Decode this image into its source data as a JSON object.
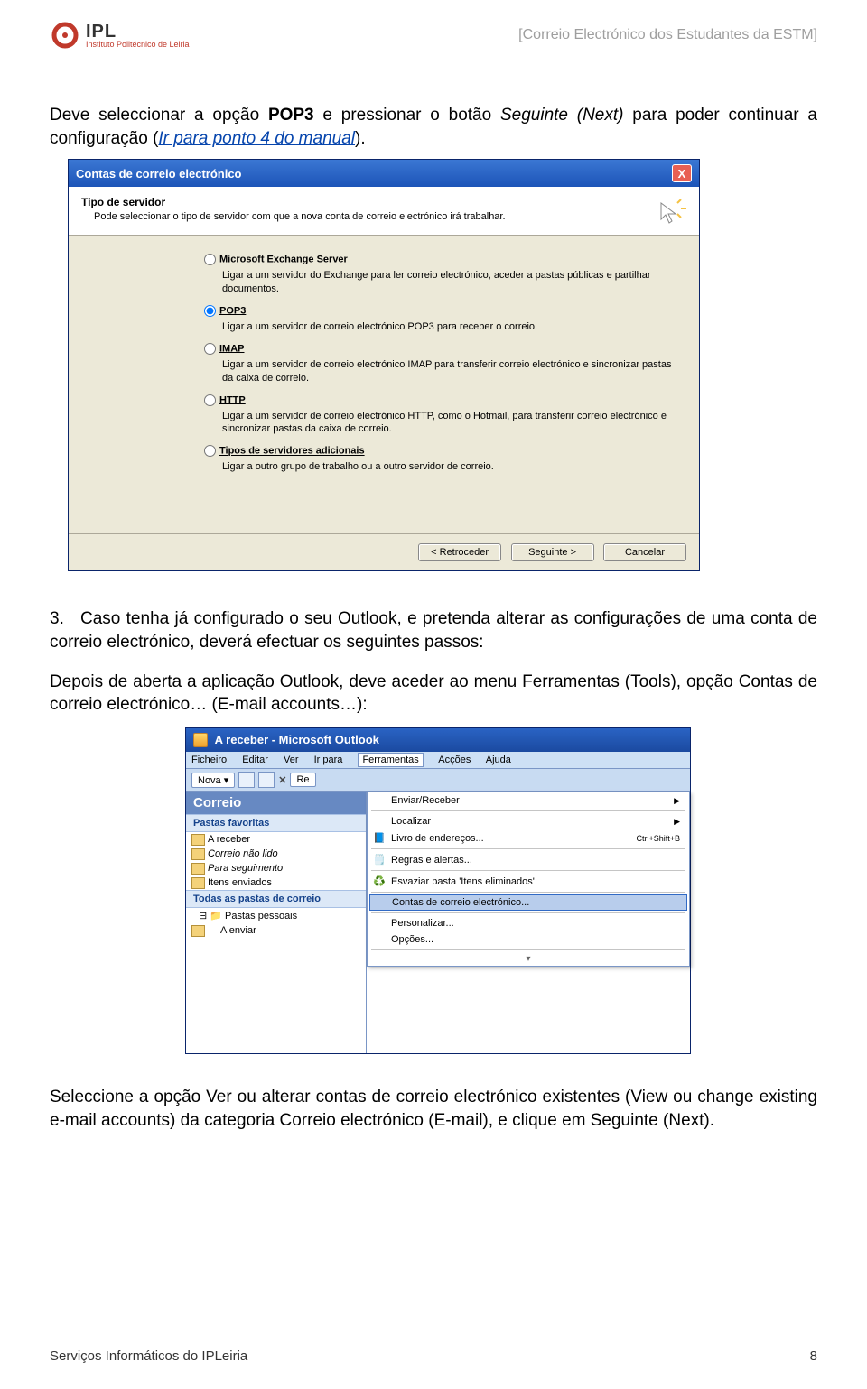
{
  "header": {
    "logo_text": "IPL",
    "logo_sub": "Instituto Politécnico de Leiria",
    "right": "[Correio Electrónico dos Estudantes da ESTM]"
  },
  "intro": {
    "p1_a": "Deve seleccionar a opção ",
    "p1_b": "POP3",
    "p1_c": " e pressionar o botão ",
    "p1_d": "Seguinte (Next)",
    "p1_e": " para poder continuar a configuração (",
    "p1_link": "Ir para ponto 4 do manual",
    "p1_f": ")."
  },
  "dialog": {
    "title": "Contas de correio electrónico",
    "head_title": "Tipo de servidor",
    "head_sub": "Pode seleccionar o tipo de servidor com que a nova conta de correio electrónico irá trabalhar.",
    "opts": [
      {
        "label": "Microsoft Exchange Server",
        "desc": "Ligar a um servidor do Exchange para ler correio electrónico, aceder a pastas públicas e partilhar documentos.",
        "checked": false
      },
      {
        "label": "POP3",
        "desc": "Ligar a um servidor de correio electrónico POP3 para receber o correio.",
        "checked": true
      },
      {
        "label": "IMAP",
        "desc": "Ligar a um servidor de correio electrónico IMAP para transferir correio electrónico e sincronizar pastas da caixa de correio.",
        "checked": false
      },
      {
        "label": "HTTP",
        "desc": "Ligar a um servidor de correio electrónico HTTP, como o Hotmail, para transferir correio electrónico e sincronizar pastas da caixa de correio.",
        "checked": false
      },
      {
        "label": "Tipos de servidores adicionais",
        "desc": "Ligar a outro grupo de trabalho ou a outro servidor de correio.",
        "checked": false
      }
    ],
    "btn_back": "< Retroceder",
    "btn_next": "Seguinte >",
    "btn_cancel": "Cancelar"
  },
  "step3": {
    "num": "3.",
    "text": "Caso tenha já configurado o seu Outlook, e pretenda alterar as configurações de uma conta de correio electrónico, deverá efectuar os seguintes passos:",
    "after": "Depois de aberta a aplicação Outlook, deve aceder ao menu Ferramentas (Tools), opção Contas de correio electrónico… (E-mail accounts…):"
  },
  "outlook": {
    "title": "A receber - Microsoft Outlook",
    "menus": [
      "Ficheiro",
      "Editar",
      "Ver",
      "Ir para",
      "Ferramentas",
      "Acções",
      "Ajuda"
    ],
    "tb_new": "Nova",
    "tb_re": "Re",
    "left_title": "Correio",
    "sec1": "Pastas favoritas",
    "fav": [
      "A receber",
      "Correio não lido",
      "Para seguimento",
      "Itens enviados"
    ],
    "sec2": "Todas as pastas de correio",
    "all1": "Pastas pessoais",
    "all2": "A enviar",
    "drop": {
      "send": "Enviar/Receber",
      "find": "Localizar",
      "addr": "Livro de endereços...",
      "addr_sc": "Ctrl+Shift+B",
      "rules": "Regras e alertas...",
      "empty": "Esvaziar pasta 'Itens eliminados'",
      "accounts": "Contas de correio electrónico...",
      "pers": "Personalizar...",
      "opts": "Opções..."
    }
  },
  "para2": "Seleccione a opção Ver ou alterar contas de correio electrónico existentes (View ou change existing e-mail accounts) da categoria Correio electrónico (E-mail), e clique em Seguinte (Next).",
  "footer": {
    "left": "Serviços Informáticos do IPLeiria",
    "right": "8"
  }
}
